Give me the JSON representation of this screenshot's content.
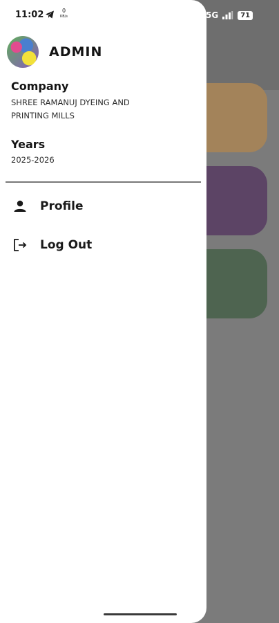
{
  "status_bar": {
    "time": "11:02",
    "data_rate_top": "0",
    "data_rate_bottom": "KB/s",
    "network": "5G",
    "battery": "71"
  },
  "drawer": {
    "username": "ADMIN",
    "company_label": "Company",
    "company_name": "SHREE RAMANUJ DYEING AND PRINTING MILLS",
    "years_label": "Years",
    "years_value": "2025-2026",
    "menu": [
      {
        "label": "Profile",
        "icon": "person-icon"
      },
      {
        "label": "Log Out",
        "icon": "logout-icon"
      }
    ]
  },
  "colors": {
    "tile_1": "#a3835a",
    "tile_2": "#5c4465",
    "tile_3": "#4e6450",
    "drawer_bg": "#ffffff"
  }
}
